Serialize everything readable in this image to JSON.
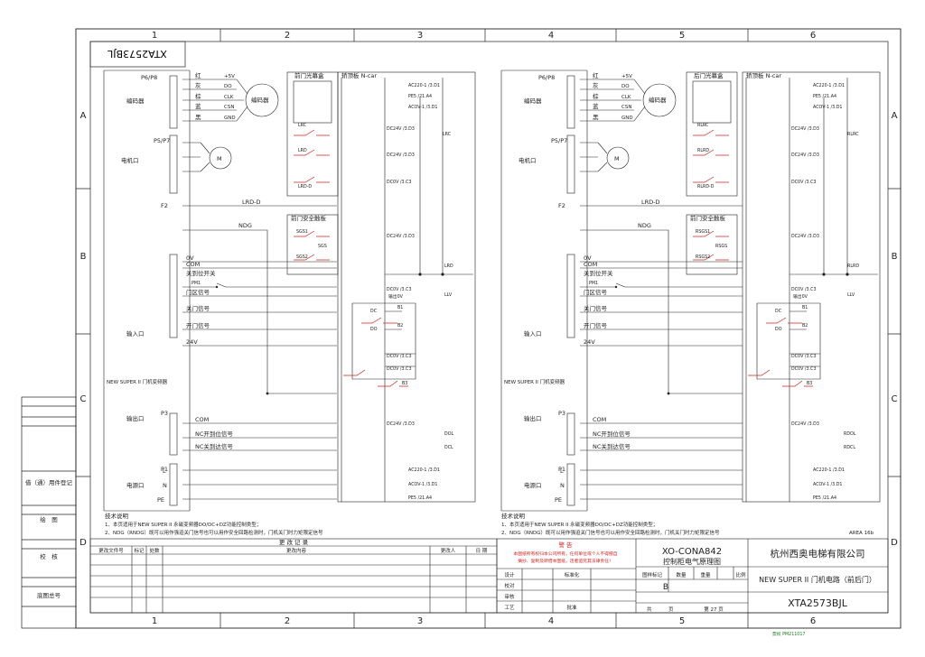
{
  "sheet": {
    "columns": [
      "1",
      "2",
      "3",
      "4",
      "5",
      "6"
    ],
    "rows": [
      "A",
      "B",
      "C",
      "D"
    ],
    "rotated_code": "XTA2573BJL",
    "area_tag": "AREA 16b",
    "stamp": "票权 PM211017"
  },
  "left_side_labels": [
    "借（通）用件登记",
    "绘　图",
    "校　核",
    "底图总号"
  ],
  "drive": {
    "label": "NEW SUPER II 门机变频器",
    "p6_p8": "P6/P8",
    "encoder_port": "编码器",
    "encoder_pins": [
      {
        "n": "1",
        "color": "红",
        "sig": "+5V"
      },
      {
        "n": "2",
        "color": "灰",
        "sig": "DO"
      },
      {
        "n": "3",
        "color": "棕",
        "sig": "CLK"
      },
      {
        "n": "4",
        "color": "蓝",
        "sig": "CSN"
      },
      {
        "n": "5",
        "color": "黑",
        "sig": "GND"
      }
    ],
    "encoder_device": "编码器",
    "motor_port": "P5/P7",
    "motor_label": "电机口",
    "motor_pins": [
      "W",
      "V",
      "U",
      "PE"
    ],
    "motor": "M",
    "f2": "F2",
    "f2_pin": "5",
    "lrd": "LRD-D",
    "pin8": "8",
    "ndg": "NDG",
    "pin11": "11",
    "pin10": "10",
    "ov": "0V",
    "com": "COM",
    "close_limit": "关到位开关",
    "pm1": "PM1",
    "inputs": [
      {
        "n": "7",
        "text": "门区信号"
      },
      {
        "n": "6",
        "text": "关门信号"
      },
      {
        "n": "5",
        "text": "开门信号"
      },
      {
        "n": "1",
        "text": "24V"
      }
    ],
    "input_port": "输入口",
    "p3": "P3",
    "output_port": "输出口",
    "outputs": [
      {
        "n": "1",
        "text": "COM"
      },
      {
        "n": "2",
        "text": "NC开到位信号"
      },
      {
        "n": "3",
        "text": "NC关到达信号"
      }
    ],
    "power_port": "电源口",
    "p1": "P1",
    "power_pins": [
      "L",
      "N",
      "PE"
    ]
  },
  "front": {
    "curtain_title": "前门光幕盒",
    "panel_title": "轿顶板 N-car",
    "safety_title": "前门安全触板",
    "ref_ac": "AC220-1 /3.D1",
    "ref_pe": "PE5 /21.A4",
    "ref_acov": "ACOV-1 /3.D1",
    "ref_24": "DC24V /3.D3",
    "ref_0v": "DC0V /3.C3",
    "ref_0v2": "DC0V /3.C3",
    "lrc": "LRC",
    "lrd": "LRD",
    "lrd_d": "LRD-D",
    "sgs1": "SGS1",
    "sgs2": "SGS2",
    "sgs": "SGS",
    "out_lrd": "LRD",
    "out_lrc": "LRC",
    "out_llv": "LLV",
    "out0v": "输出0V",
    "rel1": "B1",
    "rel2": "B2",
    "rel3": "B3",
    "dol": "DOL",
    "dcl": "DCL",
    "dc": "DC",
    "do": "DO"
  },
  "rear": {
    "curtain_title": "后门光幕盒",
    "panel_title": "轿顶板 N-car",
    "safety_title": "前门安全触板",
    "lrc": "RLRC",
    "lrd": "RLRD",
    "lrd_d": "RLRD-D",
    "sgs1": "RSGS1",
    "sgs2": "RSGS2",
    "sgs": "RSGS",
    "out_lrd": "RLRD",
    "out_lrc": "RLRC",
    "out_llv": "LLV",
    "dol": "RDOL",
    "dcl": "RDCL"
  },
  "notes": {
    "title": "技术说明",
    "lines": [
      "1、本页适用于NEW SUPER II 永磁变频器DO/DC+DZ功能控制类型；",
      "2、NDG（RNDG）既可以用作强迫关门信号也可以用作安全回路检测时，门机关门时力矩限定信号"
    ]
  },
  "change_record": {
    "title": "更 改 记 录",
    "headers": [
      "更改文件号",
      "标记",
      "处数",
      "更改内容",
      "更改人",
      "日 期"
    ]
  },
  "warning": {
    "title": "警 告",
    "text1": "本图纸所有权归本公司所有，任何单位或个人不得擅自",
    "text2": "摘抄、复制及转借本图纸，违者追究其法律责任！"
  },
  "title_block": {
    "doc_code": "XO-CONA842",
    "doc_name": "控制柜电气原理图",
    "company": "杭州西奥电梯有限公司",
    "sheet_title": "NEW SUPER II 门机电路（前后门）",
    "drawing_no": "XTA2573BJL",
    "roles": [
      "设计",
      "校对",
      "审核",
      "工艺"
    ],
    "std": "标准化",
    "approve": "批准",
    "marks": [
      "图样标记",
      "数量",
      "重量",
      "比例"
    ],
    "mark_val": "B",
    "total": "共",
    "page_word": "页",
    "sheet_no": "第 27 页"
  }
}
